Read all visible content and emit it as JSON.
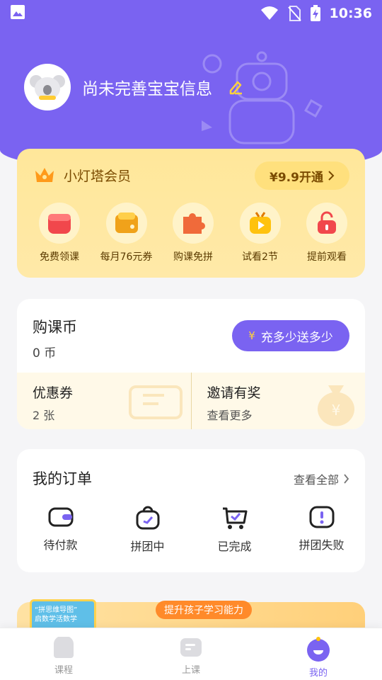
{
  "status_bar": {
    "time": "10:36"
  },
  "profile": {
    "name": "尚未完善宝宝信息"
  },
  "vip": {
    "title": "小灯塔会员",
    "button_label": "¥9.9开通",
    "items": [
      {
        "label": "免费领课",
        "icon": "gift-icon"
      },
      {
        "label": "每月76元券",
        "icon": "coupon-icon"
      },
      {
        "label": "购课免拼",
        "icon": "puzzle-icon"
      },
      {
        "label": "试看2节",
        "icon": "tv-icon"
      },
      {
        "label": "提前观看",
        "icon": "unlock-icon"
      }
    ]
  },
  "coins": {
    "title": "购课币",
    "value": "0 币",
    "button_label": "充多少送多少",
    "button_icon": "¥",
    "coupon": {
      "title": "优惠券",
      "sub": "2 张"
    },
    "invite": {
      "title": "邀请有奖",
      "sub": "查看更多"
    }
  },
  "orders": {
    "title": "我的订单",
    "view_all": "查看全部",
    "items": [
      {
        "label": "待付款",
        "icon": "wallet-icon"
      },
      {
        "label": "拼团中",
        "icon": "bag-icon"
      },
      {
        "label": "已完成",
        "icon": "cart-check-icon"
      },
      {
        "label": "拼团失败",
        "icon": "alert-icon"
      }
    ]
  },
  "banner": {
    "tag": "提升孩子学习能力",
    "book_text": "“拼思维导图”\n启数学活数学"
  },
  "tabs": [
    {
      "label": "课程",
      "icon": "course-icon"
    },
    {
      "label": "上课",
      "icon": "class-icon"
    },
    {
      "label": "我的",
      "icon": "mine-icon",
      "active": true
    }
  ],
  "colors": {
    "primary": "#7a63f1",
    "vip_bg": "#ffe79a",
    "vip_text": "#7a4b00"
  }
}
